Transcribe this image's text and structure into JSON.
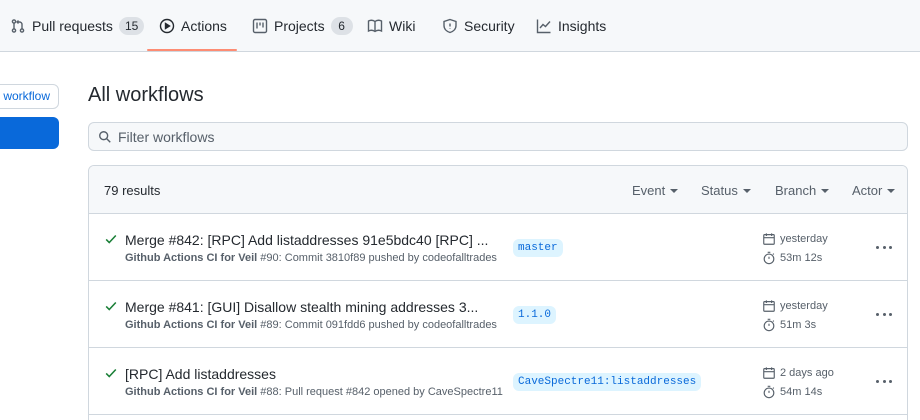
{
  "tabs": [
    {
      "label": "Pull requests",
      "counter": "15"
    },
    {
      "label": "Actions"
    },
    {
      "label": "Projects",
      "counter": "6"
    },
    {
      "label": "Wiki"
    },
    {
      "label": "Security"
    },
    {
      "label": "Insights"
    }
  ],
  "sidebar": {
    "new_workflow_label": "workflow"
  },
  "main": {
    "title": "All workflows",
    "filter_placeholder": "Filter workflows",
    "results": "79 results",
    "filters": [
      "Event",
      "Status",
      "Branch",
      "Actor"
    ]
  },
  "runs": [
    {
      "title": "Merge #842: [RPC] Add listaddresses 91e5bdc40 [RPC] ...",
      "workflow": "Github Actions CI for Veil",
      "detail": "#90: Commit 3810f89 pushed by codeofalltrades",
      "branch": "master",
      "date": "yesterday",
      "duration": "53m 12s"
    },
    {
      "title": "Merge #841: [GUI] Disallow stealth mining addresses 3...",
      "workflow": "Github Actions CI for Veil",
      "detail": "#89: Commit 091fdd6 pushed by codeofalltrades",
      "branch": "1.1.0",
      "date": "yesterday",
      "duration": "51m 3s"
    },
    {
      "title": "[RPC] Add listaddresses",
      "workflow": "Github Actions CI for Veil",
      "detail": "#88: Pull request #842 opened by CaveSpectre11",
      "branch": "CaveSpectre11:listaddresses",
      "date": "2 days ago",
      "duration": "54m 14s"
    }
  ],
  "colors": {
    "accent": "#0969da",
    "success": "#1a7f37",
    "tab_underline": "#fd8c73"
  }
}
